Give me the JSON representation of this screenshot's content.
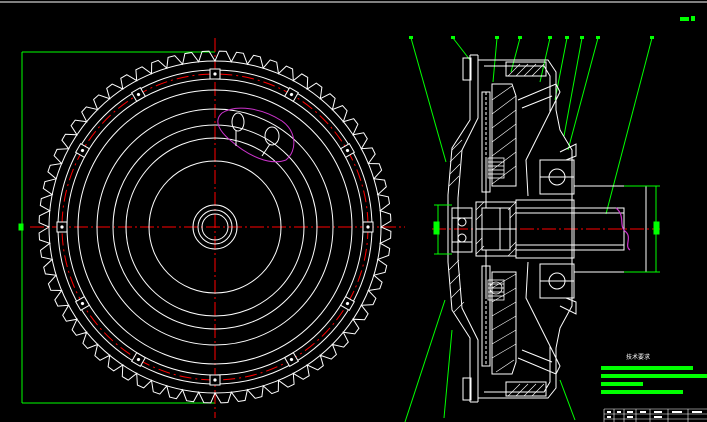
{
  "window": {
    "background": "#000000"
  },
  "notes": {
    "title": "技术要求"
  },
  "colors": {
    "outline": "#ffffff",
    "centerline": "#ff0000",
    "dimension": "#00ff00",
    "annotation": "#cc33cc",
    "hatch": "#ffffff"
  },
  "icons": {
    "corner_marker": "green-flag-icon"
  }
}
